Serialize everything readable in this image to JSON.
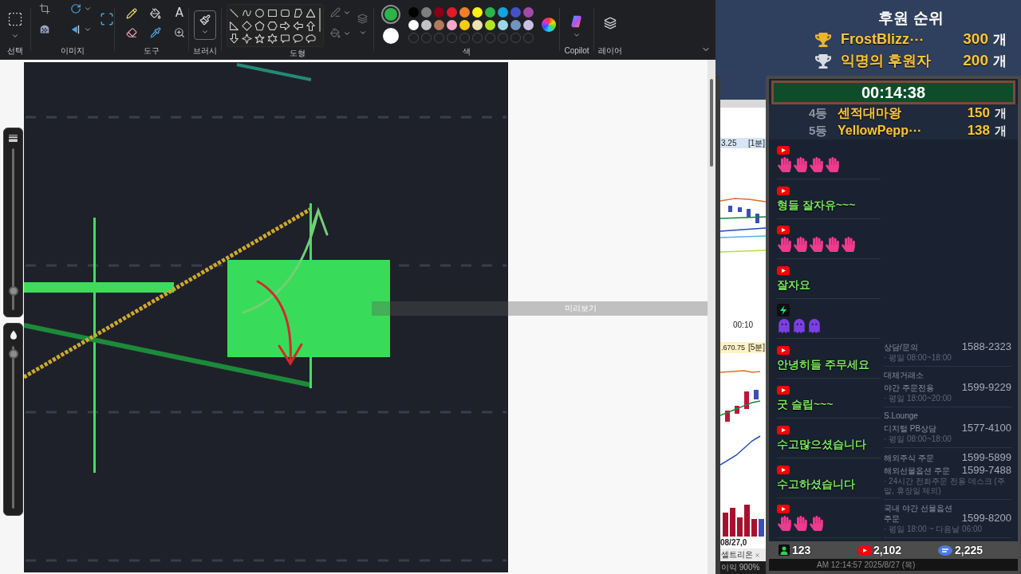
{
  "ribbon": {
    "groups": [
      {
        "kind": "select",
        "label": "선택"
      },
      {
        "kind": "image",
        "label": "이미지"
      },
      {
        "kind": "tools",
        "label": "도구",
        "text_tool": "A"
      },
      {
        "kind": "brush",
        "label": "브러시"
      },
      {
        "kind": "shapes",
        "label": "도형"
      },
      {
        "kind": "colors",
        "label": "색",
        "current": [
          {
            "color": "#2bb44a",
            "selected": true
          },
          {
            "color": "#ffffff",
            "selected": false
          }
        ],
        "palette": [
          {
            "color": "#000000"
          },
          {
            "color": "#7f7f7f"
          },
          {
            "color": "#880015"
          },
          {
            "color": "#e3192c"
          },
          {
            "color": "#f07f2a"
          },
          {
            "color": "#fcef1c"
          },
          {
            "color": "#2bb44a"
          },
          {
            "color": "#14a3e0"
          },
          {
            "color": "#4650c8"
          },
          {
            "color": "#a14ba6"
          },
          {
            "color": "#ffffff"
          },
          {
            "color": "#c3c3c3"
          },
          {
            "color": "#b27a5c"
          },
          {
            "color": "#f6a8c8"
          },
          {
            "color": "#fac815"
          },
          {
            "color": "#ede2b4"
          },
          {
            "color": "#b4e426"
          },
          {
            "color": "#9bd7e6"
          },
          {
            "color": "#7394be"
          },
          {
            "color": "#c8c0e5"
          }
        ]
      },
      {
        "kind": "copilot",
        "label": "Copilot"
      },
      {
        "kind": "layers",
        "label": "레이어"
      }
    ]
  },
  "sliders": [
    {
      "kind": "size",
      "level": 0.12
    },
    {
      "kind": "opacity",
      "level": 0.95
    }
  ],
  "preview_label": "미리보기",
  "donation_ranking": {
    "title": "후원 순위",
    "rows": [
      {
        "kind": "trophy",
        "color": "#f0b429",
        "name": "FrostBlizz⋯",
        "count": "300",
        "unit": "개"
      },
      {
        "kind": "trophy",
        "color": "#d8dde5",
        "name": "익명의 후원자",
        "count": "200",
        "unit": "개"
      },
      {
        "kind": "rank",
        "rank": "4등",
        "name": "센적대마왕",
        "count": "150",
        "unit": "개"
      },
      {
        "kind": "rank",
        "rank": "5등",
        "name": "YellowPepp⋯",
        "count": "138",
        "unit": "개"
      }
    ]
  },
  "timer": "00:14:38",
  "trading_window": {
    "quote_1": "3.25",
    "interval_1": "[1분]",
    "time_label": "00:10",
    "quote_2": ".670.75",
    "interval_2": "[5분]",
    "date_label": "08/27,0",
    "tab": "셀트리온",
    "status": "이익 900%"
  },
  "chat": {
    "messages": [
      {
        "kind": "youtube",
        "emotes": [
          {
            "kind": "hand"
          },
          {
            "kind": "hand"
          },
          {
            "kind": "hand"
          },
          {
            "kind": "hand"
          }
        ]
      },
      {
        "kind": "youtube",
        "text": "형들 잘자유~~~"
      },
      {
        "kind": "youtube",
        "emotes": [
          {
            "kind": "hand"
          },
          {
            "kind": "hand"
          },
          {
            "kind": "hand"
          },
          {
            "kind": "hand"
          },
          {
            "kind": "hand"
          }
        ]
      },
      {
        "kind": "youtube",
        "text": "잘자요"
      },
      {
        "kind": "badge",
        "emotes": [
          {
            "kind": "ghost"
          },
          {
            "kind": "ghost"
          },
          {
            "kind": "ghost"
          }
        ]
      },
      {
        "kind": "youtube",
        "text": "안녕히들 주무세요"
      },
      {
        "kind": "youtube",
        "text": "굿 슬립~~~"
      },
      {
        "kind": "youtube",
        "text": "수고많으셨습니다"
      },
      {
        "kind": "youtube",
        "text": "수고하셨습니다"
      },
      {
        "kind": "youtube",
        "emotes": [
          {
            "kind": "hand"
          },
          {
            "kind": "hand"
          },
          {
            "kind": "hand"
          }
        ]
      }
    ]
  },
  "info_panel": {
    "entries": [
      {
        "lines": [
          {
            "label": "상담/문의",
            "phone": "1588-2323"
          }
        ],
        "note": "· 평일 08:00~18:00"
      },
      {
        "heading": "대체거래소",
        "lines": [
          {
            "label": "야간 주문전용",
            "phone": "1599-9229"
          }
        ],
        "note": "· 평일 18:00~20:00"
      },
      {
        "heading": "S.Lounge",
        "lines": [
          {
            "label": "디지털 PB상담",
            "phone": "1577-4100"
          }
        ],
        "note": "· 평일 08:00~18:00"
      },
      {
        "lines": [
          {
            "label": "해외주식 주문",
            "phone": "1599-5899"
          },
          {
            "label": "해외선물옵션 주문",
            "phone": "1599-7488"
          }
        ],
        "note": "· 24시간 전화주문 전용 데스크 (주말, 휴장일 제외)"
      },
      {
        "lines": [
          {
            "label": "국내 야간 선물옵션 주문",
            "phone": "1599-8200"
          }
        ],
        "note": "· 평일 18:00 ~ 다음날 06:00"
      }
    ]
  },
  "counters": [
    {
      "kind": "viewers",
      "value": "123"
    },
    {
      "kind": "youtube",
      "value": "2,102"
    },
    {
      "kind": "chat",
      "value": "2,225"
    }
  ],
  "status_bar": "AM 12:14:57 2025/8/27 (목)"
}
